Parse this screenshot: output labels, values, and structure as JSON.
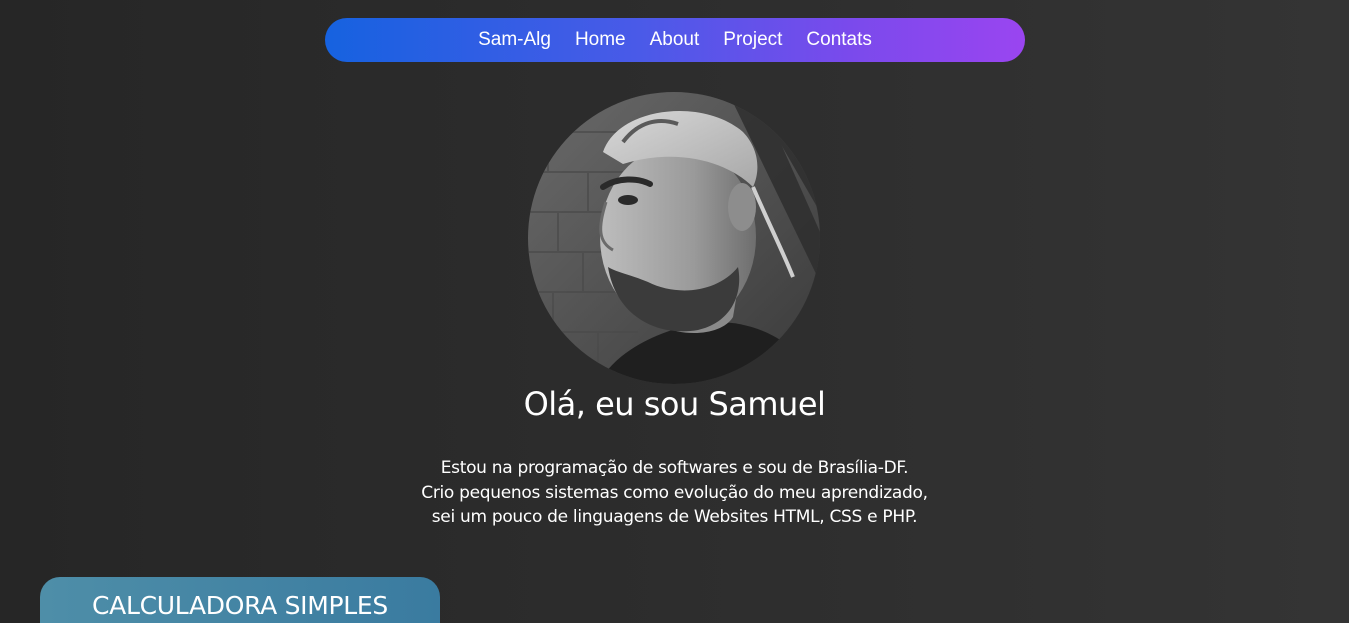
{
  "nav": {
    "items": [
      {
        "label": "Sam-Alg"
      },
      {
        "label": "Home"
      },
      {
        "label": "About"
      },
      {
        "label": "Project"
      },
      {
        "label": "Contats"
      }
    ]
  },
  "hero": {
    "title": "Olá, eu sou Samuel",
    "bio": [
      "Estou na programação de softwares e sou de Brasília-DF.",
      "Crio pequenos sistemas como evolução do meu aprendizado,",
      "sei um pouco de linguagens de Websites HTML, CSS e PHP."
    ]
  },
  "projects": [
    {
      "title": "CALCULADORA SIMPLES"
    }
  ],
  "colors": {
    "background": "#2b2b2b",
    "nav_gradient_start": "#1662e0",
    "nav_gradient_end": "#9a45f0",
    "card": "#4486a4"
  }
}
